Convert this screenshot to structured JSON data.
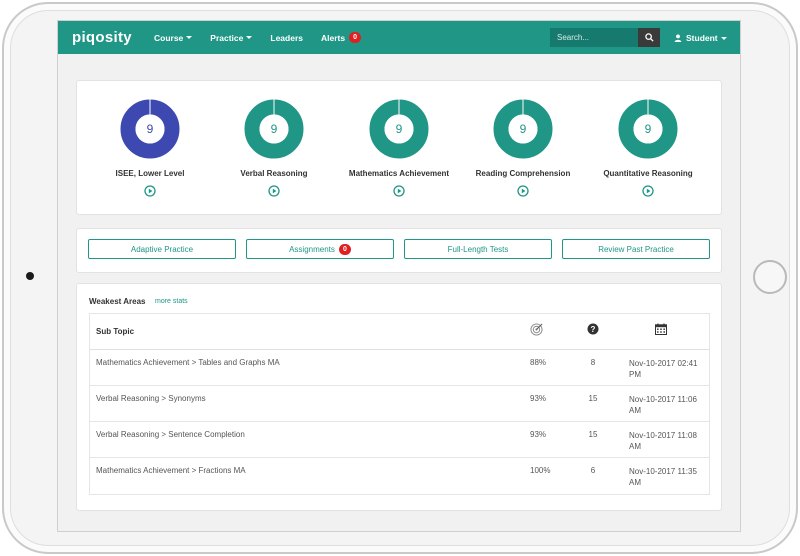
{
  "brand": "piqosity",
  "nav": {
    "course": "Course",
    "practice": "Practice",
    "leaders": "Leaders",
    "alerts": "Alerts",
    "alerts_count": "0",
    "search_placeholder": "Search...",
    "user": "Student"
  },
  "colors": {
    "teal": "#1f9686",
    "navy_blue": "#3d49b0",
    "badge_red": "#e02020"
  },
  "donuts": [
    {
      "value": "9",
      "label": "ISEE, Lower Level",
      "color": "#3d49b0"
    },
    {
      "value": "9",
      "label": "Verbal Reasoning",
      "color": "#1f9686"
    },
    {
      "value": "9",
      "label": "Mathematics Achievement",
      "color": "#1f9686"
    },
    {
      "value": "9",
      "label": "Reading Comprehension",
      "color": "#1f9686"
    },
    {
      "value": "9",
      "label": "Quantitative Reasoning",
      "color": "#1f9686"
    }
  ],
  "actions": {
    "adaptive": "Adaptive Practice",
    "assignments": "Assignments",
    "assignments_count": "0",
    "full_length": "Full-Length Tests",
    "review": "Review Past Practice"
  },
  "weakest": {
    "title": "Weakest Areas",
    "more_stats": "more stats",
    "header_subtopic": "Sub Topic",
    "header_icons": [
      "target-icon",
      "question-circle-icon",
      "calendar-icon"
    ],
    "rows": [
      {
        "topic": "Mathematics Achievement > Tables and Graphs MA",
        "accuracy": "88%",
        "questions": "8",
        "date": "Nov-10-2017 02:41 PM"
      },
      {
        "topic": "Verbal Reasoning > Synonyms",
        "accuracy": "93%",
        "questions": "15",
        "date": "Nov-10-2017 11:06 AM"
      },
      {
        "topic": "Verbal Reasoning > Sentence Completion",
        "accuracy": "93%",
        "questions": "15",
        "date": "Nov-10-2017 11:08 AM"
      },
      {
        "topic": "Mathematics Achievement > Fractions MA",
        "accuracy": "100%",
        "questions": "6",
        "date": "Nov-10-2017 11:35 AM"
      }
    ]
  }
}
